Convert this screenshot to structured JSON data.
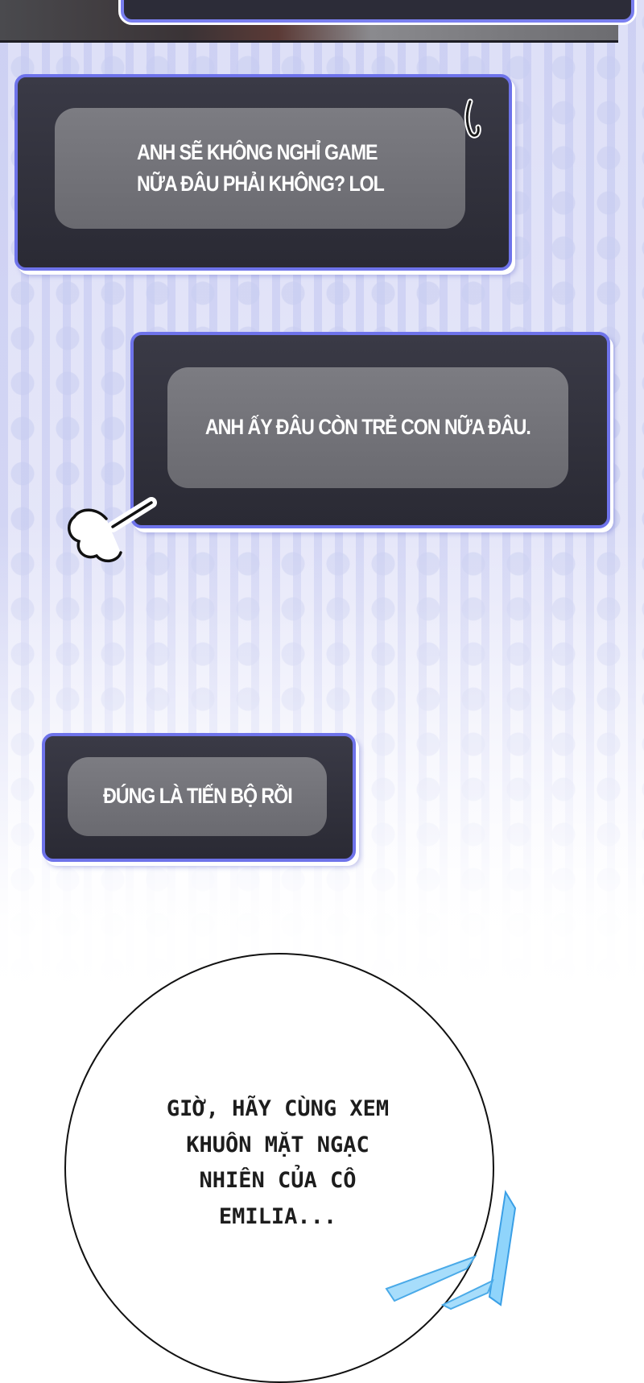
{
  "messages": [
    {
      "text": "ANH SẼ KHÔNG NGHỈ GAME\nNỮA ĐÂU PHẢI KHÔNG? LOL"
    },
    {
      "text": "ANH ẤY ĐÂU CÒN TRẺ CON NỮA ĐÂU."
    },
    {
      "text": "ĐÚNG LÀ TIẾN BỘ RỒI"
    }
  ],
  "narration": {
    "text": "GIỜ, HÃY CÙNG XEM\nKHUÔN MẶT NGẠC\nNHIÊN CỦA CÔ\nEMILIA..."
  },
  "colors": {
    "window_border": "#6e73ea",
    "window_bg": "#2f2f3a",
    "bubble_bg": "#727278",
    "accent_streak": "#5bb6f2"
  },
  "icons": [
    "sparkle-mark",
    "puff-cloud-icon",
    "speed-streak-icon"
  ]
}
